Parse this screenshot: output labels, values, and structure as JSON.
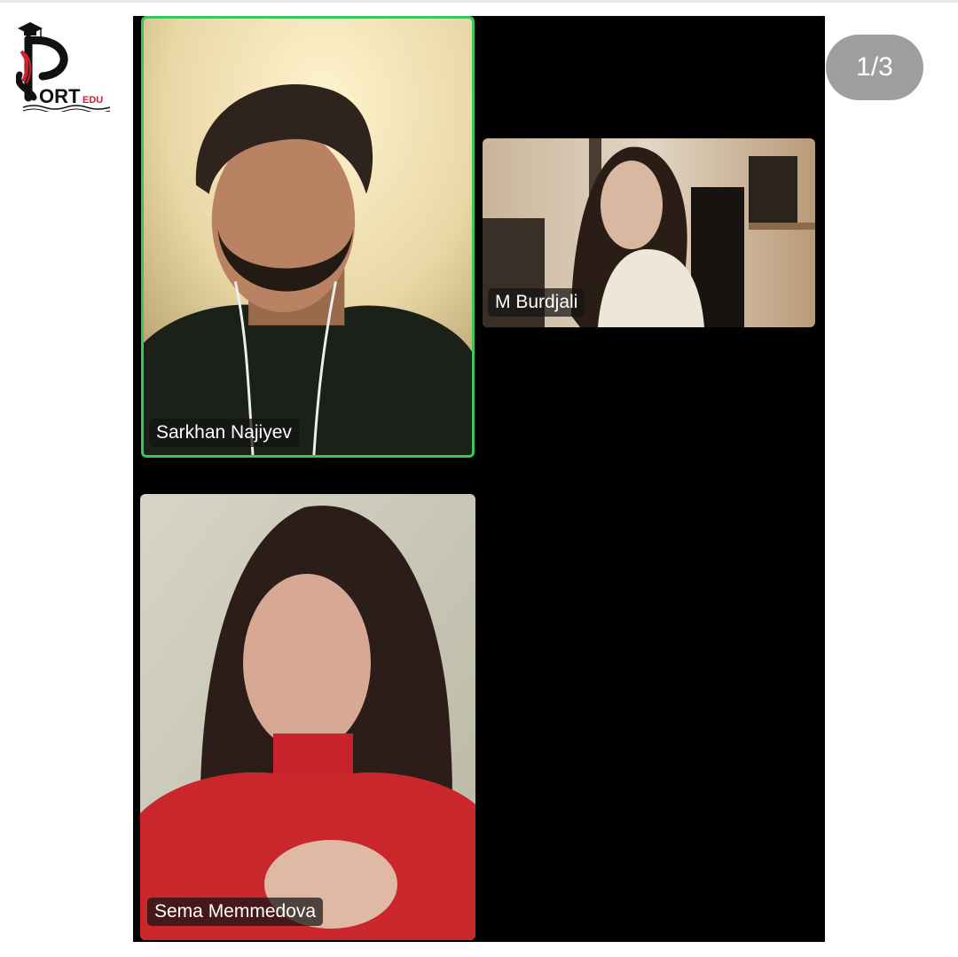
{
  "logo": {
    "text_main": "ORT",
    "text_sub": "EDU"
  },
  "counter": {
    "text": "1/3"
  },
  "participants": [
    {
      "name": "Sarkhan Najiyev",
      "active_speaker": true
    },
    {
      "name": "M Burdjali",
      "active_speaker": false
    },
    {
      "name": "Sema Memmedova",
      "active_speaker": false
    }
  ],
  "colors": {
    "call_background": "#000000",
    "active_border": "#39c65a",
    "counter_bg": "#9e9e9e",
    "logo_red": "#d31f2a"
  }
}
